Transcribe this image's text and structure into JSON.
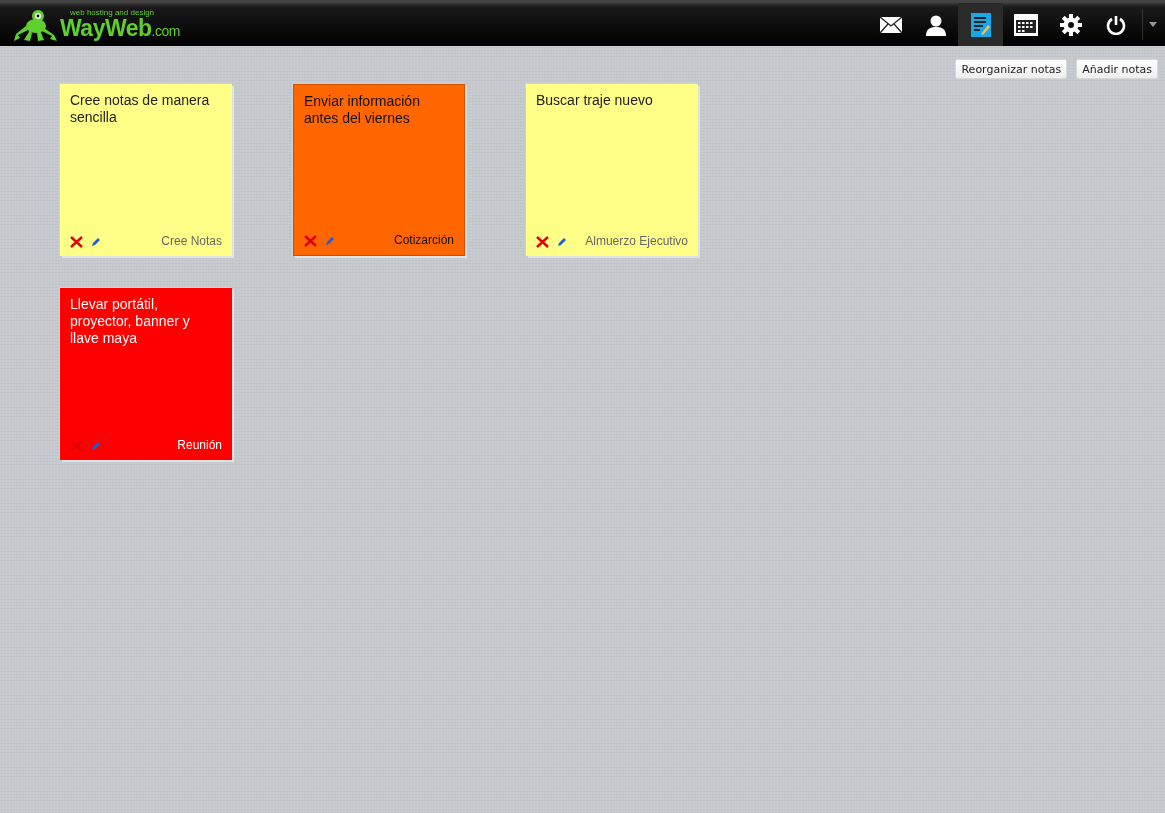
{
  "header": {
    "logo": {
      "tagline": "web hosting and design",
      "name": "WayWeb",
      "suffix": ".com"
    },
    "nav": [
      {
        "kind": "mail",
        "selected": false
      },
      {
        "kind": "user",
        "selected": false
      },
      {
        "kind": "notes",
        "selected": true
      },
      {
        "kind": "calendar",
        "selected": false
      },
      {
        "kind": "settings",
        "selected": false
      },
      {
        "kind": "power",
        "selected": false
      }
    ]
  },
  "toolbar": {
    "buttons": [
      "Reorganizar notas",
      "Añadir notas"
    ]
  },
  "notes": [
    {
      "text": "Cree notas de manera sencilla",
      "category": "Cree Notas",
      "color": "#ffff88"
    },
    {
      "text": "Enviar información antes del viernes",
      "category": "Cotizarción",
      "color": "#ff6600"
    },
    {
      "text": "Buscar traje nuevo",
      "category": "Almuerzo Ejecutivo",
      "color": "#ffff88"
    },
    {
      "text": "Llevar portátil, proyector, banner y llave maya",
      "category": "Reunión",
      "color": "#ff0000"
    }
  ]
}
